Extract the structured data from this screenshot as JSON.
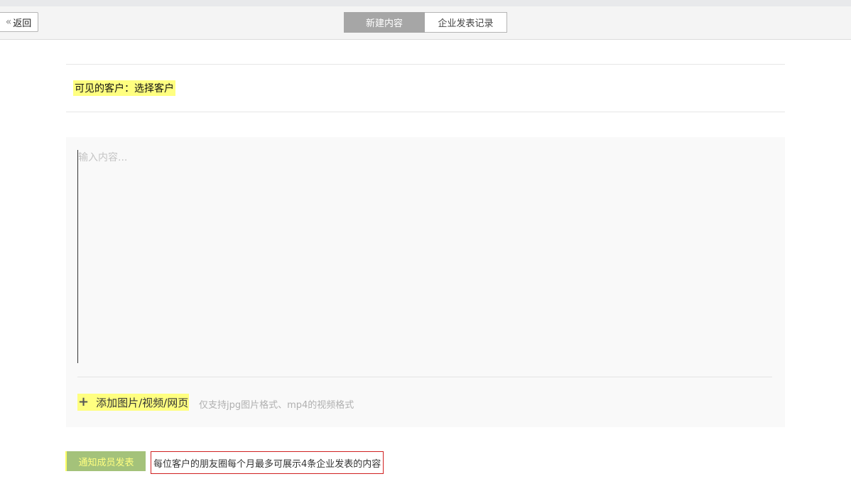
{
  "header": {
    "back_label": "返回",
    "tabs": [
      {
        "label": "新建内容",
        "active": true
      },
      {
        "label": "企业发表记录",
        "active": false
      }
    ]
  },
  "visibility": {
    "label": "可见的客户：",
    "link": "选择客户"
  },
  "editor": {
    "placeholder": "输入内容...",
    "add_media_label": "添加图片/视频/网页",
    "format_hint": "仅支持jpg图片格式、mp4的视频格式"
  },
  "footer": {
    "notify_button": "通知成员发表",
    "notice": "每位客户的朋友圈每个月最多可展示4条企业发表的内容"
  },
  "colors": {
    "highlight": "#ffff80",
    "active_tab": "#a6a6a6",
    "notify_button": "#a4c27a",
    "notice_border": "#d02020"
  }
}
